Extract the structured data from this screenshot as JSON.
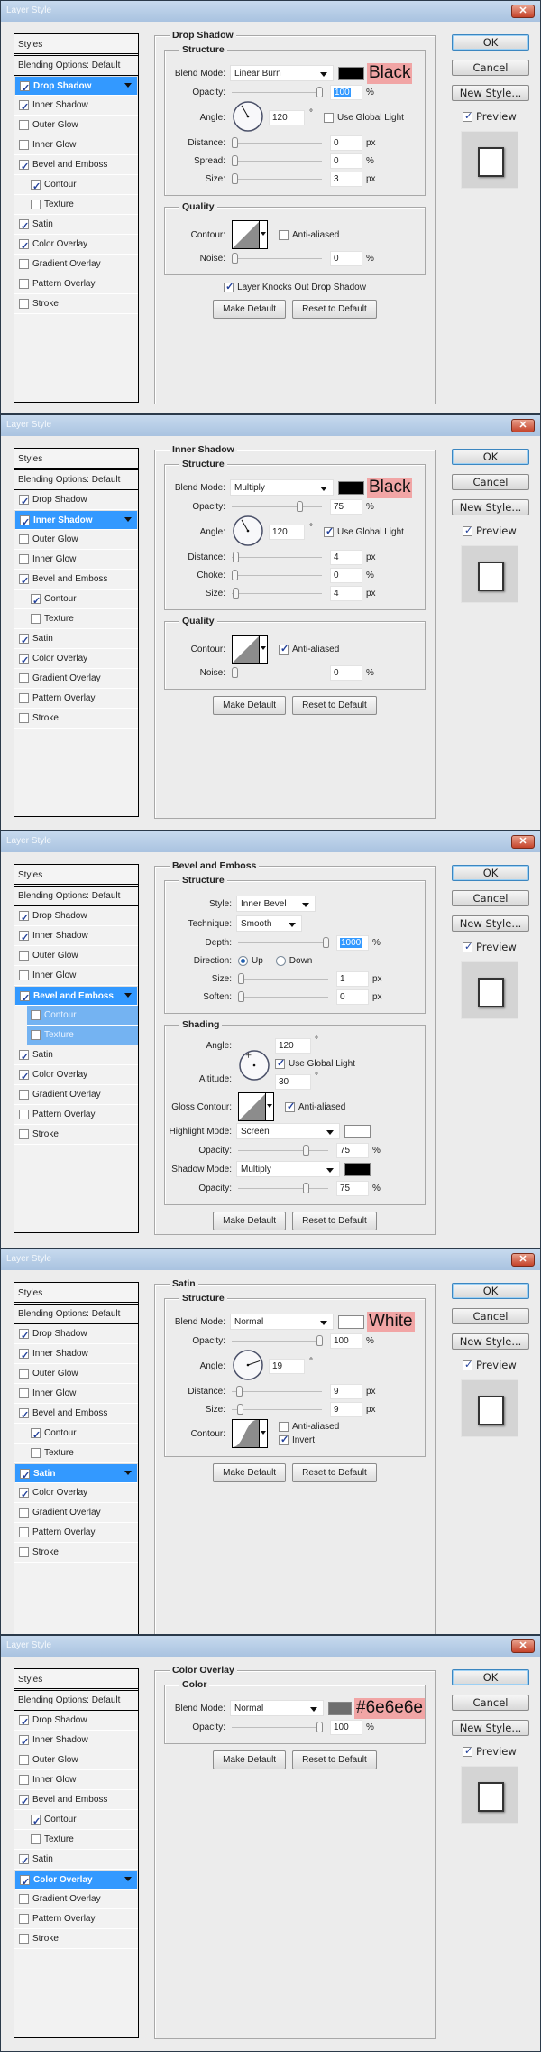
{
  "window_title": "Layer Style",
  "sidebar": {
    "header": "Styles",
    "blending": "Blending Options: Default"
  },
  "buttons": {
    "ok": "OK",
    "cancel": "Cancel",
    "new_style": "New Style...",
    "preview": "Preview",
    "preview_checked": true,
    "make_default": "Make Default",
    "reset_default": "Reset to Default"
  },
  "dialogs": [
    {
      "selected": 0,
      "styles": [
        {
          "label": "Drop Shadow",
          "checked": true
        },
        {
          "label": "Inner Shadow",
          "checked": true
        },
        {
          "label": "Outer Glow",
          "checked": false
        },
        {
          "label": "Inner Glow",
          "checked": false
        },
        {
          "label": "Bevel and Emboss",
          "checked": true
        },
        {
          "label": "Contour",
          "checked": true
        },
        {
          "label": "Texture",
          "checked": false
        },
        {
          "label": "Satin",
          "checked": true
        },
        {
          "label": "Color Overlay",
          "checked": true
        },
        {
          "label": "Gradient Overlay",
          "checked": false
        },
        {
          "label": "Pattern Overlay",
          "checked": false
        },
        {
          "label": "Stroke",
          "checked": false
        }
      ],
      "panel_title": "Drop Shadow",
      "groups": [
        {
          "title": "Structure",
          "rows": [
            {
              "type": "select",
              "label": "Blend Mode:",
              "value": "Linear Burn",
              "swatch": "#000000",
              "annotation": "Black"
            },
            {
              "type": "slider",
              "label": "Opacity:",
              "value": "100",
              "unit": "%",
              "level": 100,
              "selected": true
            },
            {
              "type": "angle",
              "label": "Angle:",
              "value": "120",
              "unit": "°",
              "global_light": {
                "label": "Use Global Light",
                "checked": false
              }
            },
            {
              "type": "slider",
              "label": "Distance:",
              "value": "0",
              "unit": "px",
              "level": 0
            },
            {
              "type": "slider",
              "label": "Spread:",
              "value": "0",
              "unit": "%",
              "level": 0
            },
            {
              "type": "slider",
              "label": "Size:",
              "value": "3",
              "unit": "px",
              "level": 3
            }
          ]
        },
        {
          "title": "Quality",
          "rows": [
            {
              "type": "contour",
              "label": "Contour:",
              "shape": "linear",
              "options": [
                {
                  "label": "Anti-aliased",
                  "checked": false
                }
              ]
            },
            {
              "type": "slider",
              "label": "Noise:",
              "value": "0",
              "unit": "%",
              "level": 0
            }
          ]
        }
      ],
      "extra_checkbox": {
        "label": "Layer Knocks Out Drop Shadow",
        "checked": true
      }
    },
    {
      "selected": 1,
      "styles": [
        {
          "label": "Drop Shadow",
          "checked": true
        },
        {
          "label": "Inner Shadow",
          "checked": true
        },
        {
          "label": "Outer Glow",
          "checked": false
        },
        {
          "label": "Inner Glow",
          "checked": false
        },
        {
          "label": "Bevel and Emboss",
          "checked": true
        },
        {
          "label": "Contour",
          "checked": true
        },
        {
          "label": "Texture",
          "checked": false
        },
        {
          "label": "Satin",
          "checked": true
        },
        {
          "label": "Color Overlay",
          "checked": true
        },
        {
          "label": "Gradient Overlay",
          "checked": false
        },
        {
          "label": "Pattern Overlay",
          "checked": false
        },
        {
          "label": "Stroke",
          "checked": false
        }
      ],
      "panel_title": "Inner Shadow",
      "groups": [
        {
          "title": "Structure",
          "rows": [
            {
              "type": "select",
              "label": "Blend Mode:",
              "value": "Multiply",
              "swatch": "#000000",
              "annotation": "Black"
            },
            {
              "type": "slider",
              "label": "Opacity:",
              "value": "75",
              "unit": "%",
              "level": 75
            },
            {
              "type": "angle",
              "label": "Angle:",
              "value": "120",
              "unit": "°",
              "global_light": {
                "label": "Use Global Light",
                "checked": true
              }
            },
            {
              "type": "slider",
              "label": "Distance:",
              "value": "4",
              "unit": "px",
              "level": 4
            },
            {
              "type": "slider",
              "label": "Choke:",
              "value": "0",
              "unit": "%",
              "level": 0
            },
            {
              "type": "slider",
              "label": "Size:",
              "value": "4",
              "unit": "px",
              "level": 4
            }
          ]
        },
        {
          "title": "Quality",
          "rows": [
            {
              "type": "contour",
              "label": "Contour:",
              "shape": "linear",
              "options": [
                {
                  "label": "Anti-aliased",
                  "checked": true
                }
              ]
            },
            {
              "type": "slider",
              "label": "Noise:",
              "value": "0",
              "unit": "%",
              "level": 0
            }
          ]
        }
      ]
    },
    {
      "selected": 4,
      "styles": [
        {
          "label": "Drop Shadow",
          "checked": true
        },
        {
          "label": "Inner Shadow",
          "checked": true
        },
        {
          "label": "Outer Glow",
          "checked": false
        },
        {
          "label": "Inner Glow",
          "checked": false
        },
        {
          "label": "Bevel and Emboss",
          "checked": true
        },
        {
          "label": "Contour",
          "checked": false
        },
        {
          "label": "Texture",
          "checked": false
        },
        {
          "label": "Satin",
          "checked": true
        },
        {
          "label": "Color Overlay",
          "checked": true
        },
        {
          "label": "Gradient Overlay",
          "checked": false
        },
        {
          "label": "Pattern Overlay",
          "checked": false
        },
        {
          "label": "Stroke",
          "checked": false
        }
      ],
      "panel_title": "Bevel and Emboss",
      "groups": [
        {
          "title": "Structure",
          "rows": [
            {
              "type": "select",
              "label": "Style:",
              "value": "Inner Bevel",
              "size": "medium"
            },
            {
              "type": "select",
              "label": "Technique:",
              "value": "Smooth",
              "size": "small"
            },
            {
              "type": "slider",
              "label": "Depth:",
              "value": "1000",
              "unit": "%",
              "level": 100,
              "selected": true
            },
            {
              "type": "radio",
              "label": "Direction:",
              "options": [
                {
                  "label": "Up",
                  "checked": true
                },
                {
                  "label": "Down",
                  "checked": false
                }
              ]
            },
            {
              "type": "slider",
              "label": "Size:",
              "value": "1",
              "unit": "px",
              "level": 1
            },
            {
              "type": "slider",
              "label": "Soften:",
              "value": "0",
              "unit": "px",
              "level": 0
            }
          ]
        },
        {
          "title": "Shading",
          "rows": [
            {
              "type": "shading-angle",
              "label": "Angle:",
              "value": "120",
              "unit": "°",
              "global_light": {
                "label": "Use Global Light",
                "checked": true
              },
              "altitude_label": "Altitude:",
              "altitude": "30",
              "altitude_unit": "°"
            },
            {
              "type": "contour",
              "label": "Gloss Contour:",
              "shape": "linear",
              "options": [
                {
                  "label": "Anti-aliased",
                  "checked": true
                }
              ]
            },
            {
              "type": "select",
              "label": "Highlight Mode:",
              "value": "Screen",
              "swatch": "#ffffff"
            },
            {
              "type": "slider",
              "label": "Opacity:",
              "value": "75",
              "unit": "%",
              "level": 75
            },
            {
              "type": "select",
              "label": "Shadow Mode:",
              "value": "Multiply",
              "swatch": "#000000"
            },
            {
              "type": "slider",
              "label": "Opacity:",
              "value": "75",
              "unit": "%",
              "level": 75
            }
          ]
        }
      ]
    },
    {
      "selected": 7,
      "styles": [
        {
          "label": "Drop Shadow",
          "checked": true
        },
        {
          "label": "Inner Shadow",
          "checked": true
        },
        {
          "label": "Outer Glow",
          "checked": false
        },
        {
          "label": "Inner Glow",
          "checked": false
        },
        {
          "label": "Bevel and Emboss",
          "checked": true
        },
        {
          "label": "Contour",
          "checked": true
        },
        {
          "label": "Texture",
          "checked": false
        },
        {
          "label": "Satin",
          "checked": true
        },
        {
          "label": "Color Overlay",
          "checked": true
        },
        {
          "label": "Gradient Overlay",
          "checked": false
        },
        {
          "label": "Pattern Overlay",
          "checked": false
        },
        {
          "label": "Stroke",
          "checked": false
        }
      ],
      "panel_title": "Satin",
      "groups": [
        {
          "title": "Structure",
          "rows": [
            {
              "type": "select",
              "label": "Blend Mode:",
              "value": "Normal",
              "swatch": "#ffffff",
              "annotation": "White"
            },
            {
              "type": "slider",
              "label": "Opacity:",
              "value": "100",
              "unit": "%",
              "level": 100
            },
            {
              "type": "angle",
              "label": "Angle:",
              "value": "19",
              "unit": "°"
            },
            {
              "type": "slider",
              "label": "Distance:",
              "value": "9",
              "unit": "px",
              "level": 8
            },
            {
              "type": "slider",
              "label": "Size:",
              "value": "9",
              "unit": "px",
              "level": 9
            },
            {
              "type": "contour",
              "label": "Contour:",
              "shape": "gaussian",
              "options": [
                {
                  "label": "Anti-aliased",
                  "checked": false
                },
                {
                  "label": "Invert",
                  "checked": true
                }
              ]
            }
          ]
        }
      ]
    },
    {
      "selected": 8,
      "styles": [
        {
          "label": "Drop Shadow",
          "checked": true
        },
        {
          "label": "Inner Shadow",
          "checked": true
        },
        {
          "label": "Outer Glow",
          "checked": false
        },
        {
          "label": "Inner Glow",
          "checked": false
        },
        {
          "label": "Bevel and Emboss",
          "checked": true
        },
        {
          "label": "Contour",
          "checked": true
        },
        {
          "label": "Texture",
          "checked": false
        },
        {
          "label": "Satin",
          "checked": true
        },
        {
          "label": "Color Overlay",
          "checked": true
        },
        {
          "label": "Gradient Overlay",
          "checked": false
        },
        {
          "label": "Pattern Overlay",
          "checked": false
        },
        {
          "label": "Stroke",
          "checked": false
        }
      ],
      "panel_title": "Color Overlay",
      "groups": [
        {
          "title": "Color",
          "rows": [
            {
              "type": "select",
              "label": "Blend Mode:",
              "value": "Normal",
              "swatch": "#6e6e6e",
              "annotation": "#6e6e6e"
            },
            {
              "type": "slider",
              "label": "Opacity:",
              "value": "100",
              "unit": "%",
              "level": 100
            }
          ]
        }
      ]
    }
  ]
}
